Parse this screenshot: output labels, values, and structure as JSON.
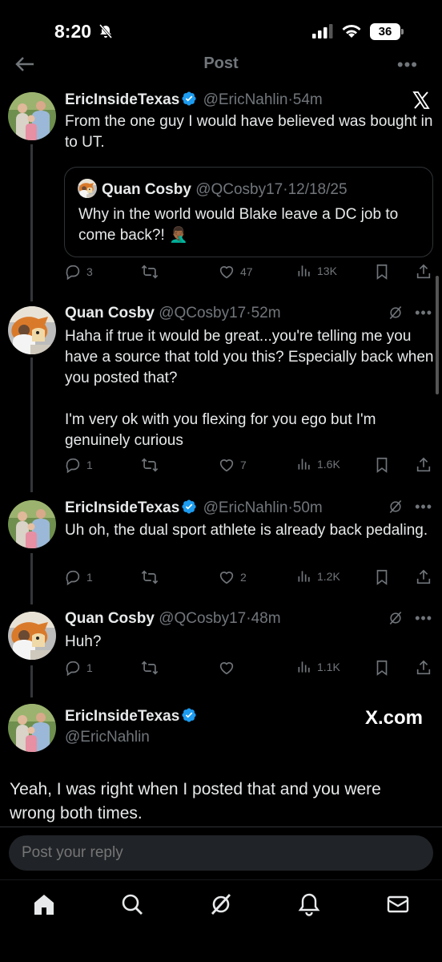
{
  "status": {
    "time": "8:20",
    "battery": "36"
  },
  "header": {
    "title": "Post"
  },
  "posts": [
    {
      "name": "EricInsideTexas",
      "handle": "@EricNahlin",
      "dot": "·",
      "time": "54m",
      "text": "From the one guy I would have believed was bought in to UT.",
      "quote": {
        "name": "Quan Cosby",
        "handle": "@QCosby17",
        "dot": "·",
        "date": "12/18/25",
        "text": "Why in the world would Blake leave a DC job to come back?! 🤦🏾‍♂️"
      },
      "replies": "3",
      "reposts": "",
      "likes": "47",
      "views": "13K"
    },
    {
      "name": "Quan Cosby",
      "handle": "@QCosby17",
      "dot": "·",
      "time": "52m",
      "text": "Haha if true it would be great...you're telling me you have a source that told you this? Especially back when you posted that?\n\nI'm very ok with you flexing for you ego but I'm genuinely curious",
      "replies": "1",
      "reposts": "",
      "likes": "7",
      "views": "1.6K"
    },
    {
      "name": "EricInsideTexas",
      "handle": "@EricNahlin",
      "dot": "·",
      "time": "50m",
      "text": "Uh oh, the dual sport athlete is already back pedaling.",
      "replies": "1",
      "reposts": "",
      "likes": "2",
      "views": "1.2K"
    },
    {
      "name": "Quan Cosby",
      "handle": "@QCosby17",
      "dot": "·",
      "time": "48m",
      "text": "Huh?",
      "replies": "1",
      "reposts": "",
      "likes": "",
      "views": "1.1K"
    }
  ],
  "main_post": {
    "name": "EricInsideTexas",
    "handle": "@EricNahlin",
    "source": "X.com",
    "text": "Yeah, I was right when I posted that and you were wrong both times."
  },
  "reply": {
    "placeholder": "Post your reply"
  },
  "icons": {
    "back": "back-arrow-icon",
    "more": "more-icon",
    "verified": "verified-badge-icon",
    "reply": "reply-icon",
    "repost": "repost-icon",
    "like": "heart-icon",
    "views": "views-icon",
    "bookmark": "bookmark-icon",
    "share": "share-icon",
    "grok": "grok-icon",
    "home": "home-icon",
    "search": "search-icon",
    "notifications": "bell-icon",
    "messages": "mail-icon"
  },
  "colors": {
    "background": "#000000",
    "text": "#e7e9ea",
    "muted": "#71767b",
    "verified": "#1d9bf0",
    "divider": "#2f3336"
  }
}
